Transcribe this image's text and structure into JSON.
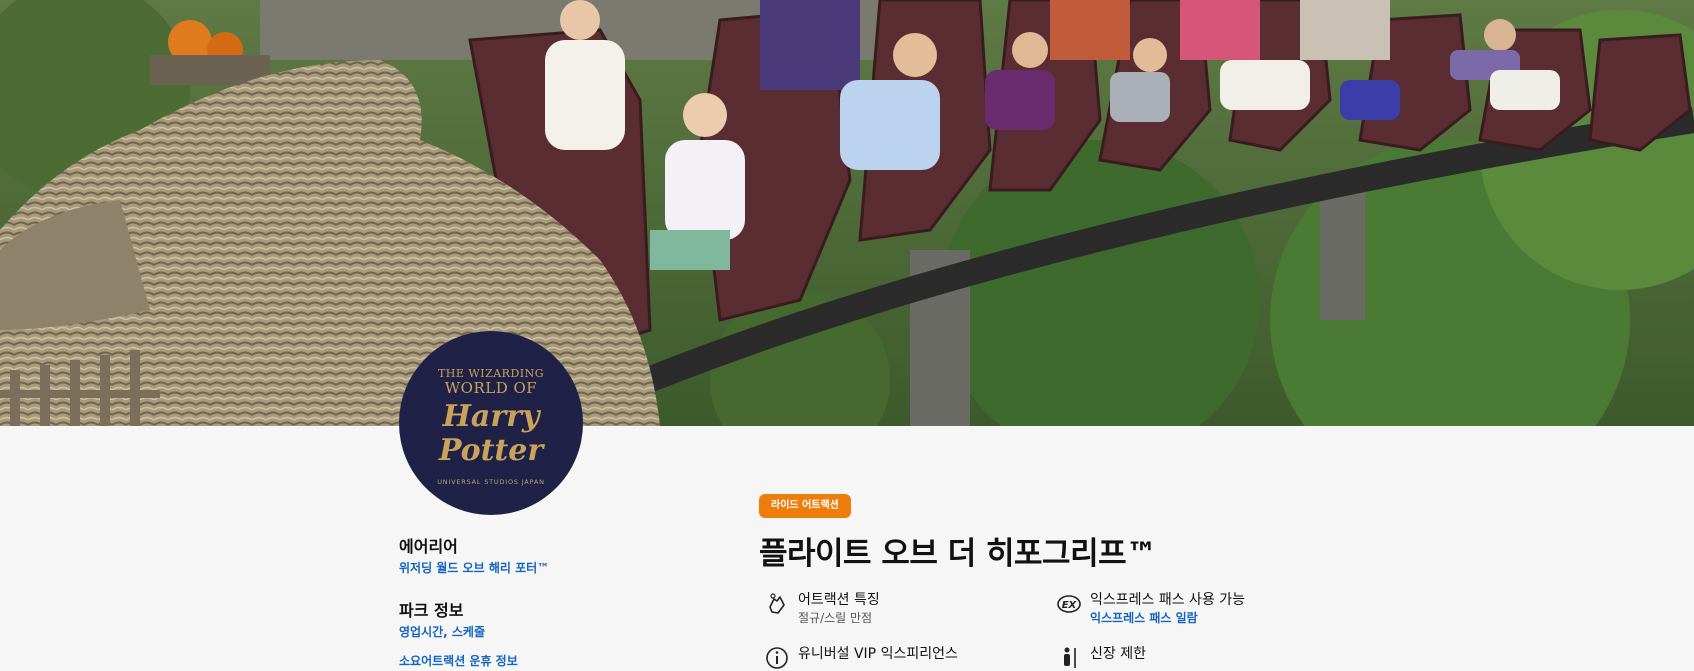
{
  "hero": {
    "alt": "flight-of-the-hippogriff-coaster-photo"
  },
  "logo": {
    "line1": "THE WIZARDING",
    "line2": "WORLD OF",
    "line3": "Harry Potter",
    "line4": "UNIVERSAL STUDIOS JAPAN"
  },
  "sidebar": {
    "area_label": "에어리어",
    "area_link": "위저딩 월드 오브 해리 포터™",
    "park_label": "파크 정보",
    "park_link": "영업시간, 스케줄",
    "more_link": "소요어트랙션 운휴 정보"
  },
  "badge": "라이드 어트랙션",
  "title": "플라이트 오브 더 히포그리프™",
  "features": {
    "attraction_title": "어트랙션 특징",
    "attraction_value": "절규/스릴 만점",
    "express_title": "익스프레스 패스 사용 가능",
    "express_link": "익스프레스 패스 일람",
    "vip_title": "유니버설 VIP 익스피리언스",
    "height_title": "신장 제한"
  },
  "colors": {
    "accent_orange": "#ef7d0c",
    "link_blue": "#1565c0",
    "logo_navy": "#1f2147",
    "logo_gold": "#c9a35b"
  },
  "icons": [
    "hand-rings-icon",
    "express-pass-icon",
    "info-icon",
    "height-icon"
  ]
}
